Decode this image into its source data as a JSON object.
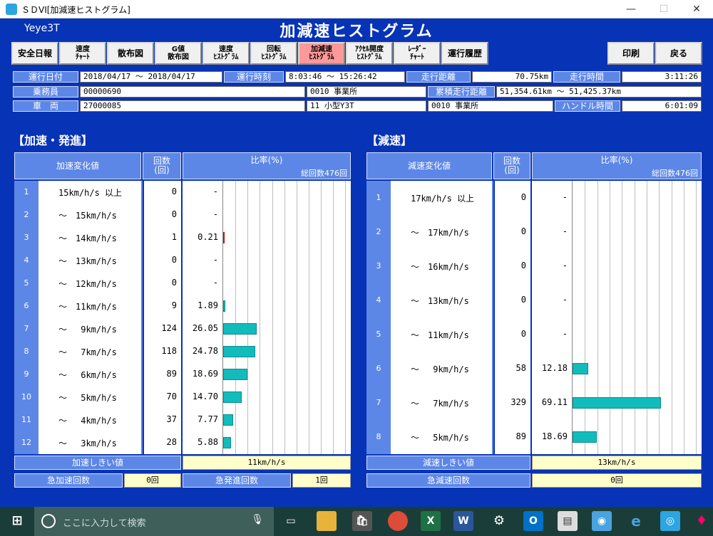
{
  "window": {
    "title": "ＳＤVI[加減速ヒストグラム]",
    "minimize": "—",
    "maximize": "☐",
    "close": "✕"
  },
  "app_name": "Yeye3T",
  "screen_title": "加減速ヒストグラム",
  "toolbar": {
    "safety_report": "安全日報",
    "speed_chart": "速度\nﾁｬｰﾄ",
    "scatter": "散布図",
    "g_scatter": "G値\n散布図",
    "speed_hist": "速度\nﾋｽﾄｸﾞﾗﾑ",
    "rotation_hist": "回転\nﾋｽﾄｸﾞﾗﾑ",
    "accel_hist": "加減速\nﾋｽﾄｸﾞﾗﾑ",
    "accel_pedal_hist": "ｱｸｾﾙ開度\nﾋｽﾄｸﾞﾗﾑ",
    "radar_chart": "ﾚｰﾀﾞｰ\nﾁｬｰﾄ",
    "run_history": "運行履歴",
    "print": "印刷",
    "back": "戻る"
  },
  "info": {
    "run_date_label": "運行日付",
    "run_date_value": "2018/04/17 ～ 2018/04/17",
    "run_time_label": "運行時刻",
    "run_time_value": "8:03:46 ～ 15:26:42",
    "distance_label": "走行距離",
    "distance_value": "70.75km",
    "drive_time_label": "走行時間",
    "drive_time_value": "3:11:26",
    "crew_label": "乗務員",
    "crew_value": "00000690",
    "crew_office": "0010 事業所",
    "cumulative_label": "累積走行距離",
    "cumulative_value": "51,354.61km ～ 51,425.37km",
    "vehicle_label": "車　両",
    "vehicle_value": "27000085",
    "vehicle_type": "11 小型Y3T",
    "vehicle_office": "0010 事業所",
    "handle_label": "ハンドル時間",
    "handle_value": "6:01:09"
  },
  "accel": {
    "section_title": "【加速・発進】",
    "col_change": "加速変化値",
    "col_count": "回数\n(回)",
    "col_ratio": "比率(%)",
    "total": "総回数476回",
    "rows": [
      {
        "no": "1",
        "label": "15km/h/s 以上",
        "count": "0",
        "ratio": "-"
      },
      {
        "no": "2",
        "label": "～　15km/h/s",
        "count": "0",
        "ratio": "-"
      },
      {
        "no": "3",
        "label": "～　14km/h/s",
        "count": "1",
        "ratio": "0.21"
      },
      {
        "no": "4",
        "label": "～　13km/h/s",
        "count": "0",
        "ratio": "-"
      },
      {
        "no": "5",
        "label": "～　12km/h/s",
        "count": "0",
        "ratio": "-"
      },
      {
        "no": "6",
        "label": "～　11km/h/s",
        "count": "9",
        "ratio": "1.89"
      },
      {
        "no": "7",
        "label": "～　 9km/h/s",
        "count": "124",
        "ratio": "26.05"
      },
      {
        "no": "8",
        "label": "～　 7km/h/s",
        "count": "118",
        "ratio": "24.78"
      },
      {
        "no": "9",
        "label": "～　 6km/h/s",
        "count": "89",
        "ratio": "18.69"
      },
      {
        "no": "10",
        "label": "～　 5km/h/s",
        "count": "70",
        "ratio": "14.70"
      },
      {
        "no": "11",
        "label": "～　 4km/h/s",
        "count": "37",
        "ratio": "7.77"
      },
      {
        "no": "12",
        "label": "～　 3km/h/s",
        "count": "28",
        "ratio": "5.88"
      }
    ],
    "threshold_label": "加速しきい値",
    "threshold_value": "11km/h/s",
    "sudden_accel_label": "急加速回数",
    "sudden_accel_value": "0回",
    "sudden_start_label": "急発進回数",
    "sudden_start_value": "1回"
  },
  "decel": {
    "section_title": "【減速】",
    "col_change": "減速変化値",
    "col_count": "回数\n(回)",
    "col_ratio": "比率(%)",
    "total": "総回数476回",
    "rows": [
      {
        "no": "1",
        "label": "17km/h/s 以上",
        "count": "0",
        "ratio": "-"
      },
      {
        "no": "2",
        "label": "～　17km/h/s",
        "count": "0",
        "ratio": "-"
      },
      {
        "no": "3",
        "label": "～　16km/h/s",
        "count": "0",
        "ratio": "-"
      },
      {
        "no": "4",
        "label": "～　13km/h/s",
        "count": "0",
        "ratio": "-"
      },
      {
        "no": "5",
        "label": "～　11km/h/s",
        "count": "0",
        "ratio": "-"
      },
      {
        "no": "6",
        "label": "～　 9km/h/s",
        "count": "58",
        "ratio": "12.18"
      },
      {
        "no": "7",
        "label": "～　 7km/h/s",
        "count": "329",
        "ratio": "69.11"
      },
      {
        "no": "8",
        "label": "～　 5km/h/s",
        "count": "89",
        "ratio": "18.69"
      }
    ],
    "threshold_label": "減速しきい値",
    "threshold_value": "13km/h/s",
    "sudden_decel_label": "急減速回数",
    "sudden_decel_value": "0回"
  },
  "chart_data": [
    {
      "type": "bar",
      "categories": [
        "1",
        "2",
        "3",
        "4",
        "5",
        "6",
        "7",
        "8",
        "9",
        "10",
        "11",
        "12"
      ],
      "values": [
        0,
        0,
        0.21,
        0,
        0,
        1.89,
        26.05,
        24.78,
        18.69,
        14.7,
        7.77,
        5.88
      ],
      "xlim": [
        0,
        100
      ]
    },
    {
      "type": "bar",
      "categories": [
        "1",
        "2",
        "3",
        "4",
        "5",
        "6",
        "7",
        "8"
      ],
      "values": [
        0,
        0,
        0,
        0,
        0,
        12.18,
        69.11,
        18.69
      ],
      "xlim": [
        0,
        100
      ]
    }
  ],
  "taskbar": {
    "search_placeholder": "ここに入力して検索",
    "icons": [
      "windows-icon",
      "task-view-icon",
      "file-explorer-icon",
      "store-icon",
      "chrome-icon",
      "excel-icon",
      "word-icon",
      "settings-icon",
      "outlook-icon",
      "document-icon",
      "app-icon",
      "edge-icon",
      "sdvi-icon",
      "paint-icon"
    ]
  },
  "colors": {
    "accent": "#0733b6",
    "header": "#5d87e6",
    "bar": "#13bcbc",
    "active_tab": "#ff9999",
    "highlight_bar": "#e0301e"
  }
}
